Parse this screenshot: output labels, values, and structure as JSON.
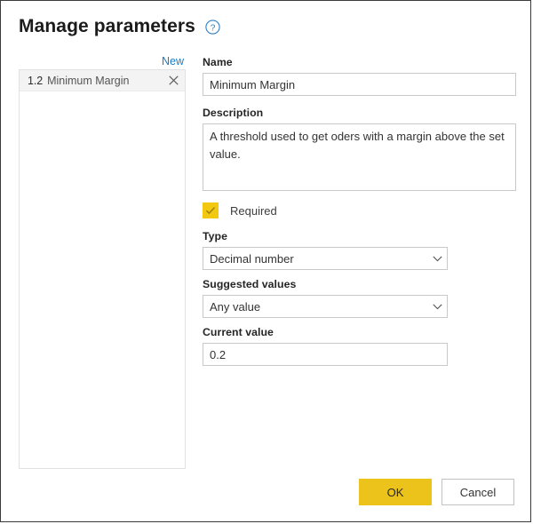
{
  "dialog": {
    "title": "Manage parameters",
    "help_icon": "help-circle-icon"
  },
  "left_panel": {
    "new_label": "New",
    "items": [
      {
        "type_badge": "1.2",
        "name": "Minimum Margin",
        "remove_icon": "close-x-icon"
      }
    ]
  },
  "form": {
    "name": {
      "label": "Name",
      "value": "Minimum Margin",
      "placeholder": ""
    },
    "description": {
      "label": "Description",
      "value": "A threshold used to get oders with a margin above the set value.",
      "placeholder": ""
    },
    "required": {
      "label": "Required",
      "checked": true,
      "check_icon": "checkmark-icon"
    },
    "type": {
      "label": "Type",
      "value": "Decimal number",
      "chevron_icon": "chevron-down-icon"
    },
    "suggested_values": {
      "label": "Suggested values",
      "value": "Any value",
      "chevron_icon": "chevron-down-icon"
    },
    "current_value": {
      "label": "Current value",
      "value": "0.2",
      "placeholder": ""
    }
  },
  "footer": {
    "ok_label": "OK",
    "cancel_label": "Cancel"
  },
  "colors": {
    "accent_yellow": "#F2C811",
    "button_yellow": "#EBC31A",
    "link_blue": "#1A7BC4",
    "border_gray": "#C9C9C9",
    "dialog_border": "#3B3B3B"
  }
}
